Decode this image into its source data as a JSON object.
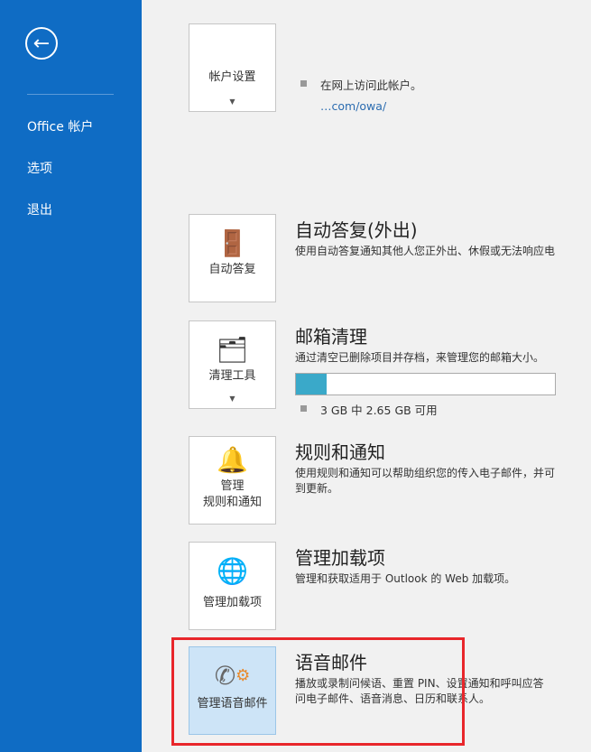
{
  "sidebar": {
    "back_icon": "arrow-left-icon",
    "items": [
      {
        "label": "Office 帐户"
      },
      {
        "label": "选项"
      },
      {
        "label": "退出"
      }
    ]
  },
  "sections": [
    {
      "tile": "帐户设置",
      "icon": "account-settings-icon",
      "bullet": "在网上访问此帐户。",
      "link": "…com/owa/"
    },
    {
      "tile": "自动答复",
      "icon": "auto-reply-icon",
      "title": "自动答复(外出)",
      "desc": "使用自动答复通知其他人您正外出、休假或无法响应电"
    },
    {
      "tile": "清理工具",
      "icon": "cleanup-tools-icon",
      "title": "邮箱清理",
      "desc": "通过清空已删除项目并存档，来管理您的邮箱大小。",
      "storage": "3 GB 中 2.65 GB 可用",
      "used_fraction": 0.117
    },
    {
      "tile": "管理\n规则和通知",
      "tile_l1": "管理",
      "tile_l2": "规则和通知",
      "icon": "rules-icon",
      "title": "规则和通知",
      "desc1": "使用规则和通知可以帮助组织您的传入电子邮件，并可",
      "desc2": "到更新。"
    },
    {
      "tile": "管理加载项",
      "icon": "globe-gear-icon",
      "title": "管理加载项",
      "desc": "管理和获取适用于 Outlook 的 Web 加载项。"
    },
    {
      "tile": "管理语音邮件",
      "icon": "phone-gear-icon",
      "title": "语音邮件",
      "desc1": "播放或录制问候语、重置 PIN、设置通知和呼叫应答",
      "desc2": "问电子邮件、语音消息、日历和联系人。"
    }
  ],
  "colors": {
    "sidebar": "#0f6cc4",
    "highlight": "#e8262b",
    "bar": "#3aa9c9"
  }
}
